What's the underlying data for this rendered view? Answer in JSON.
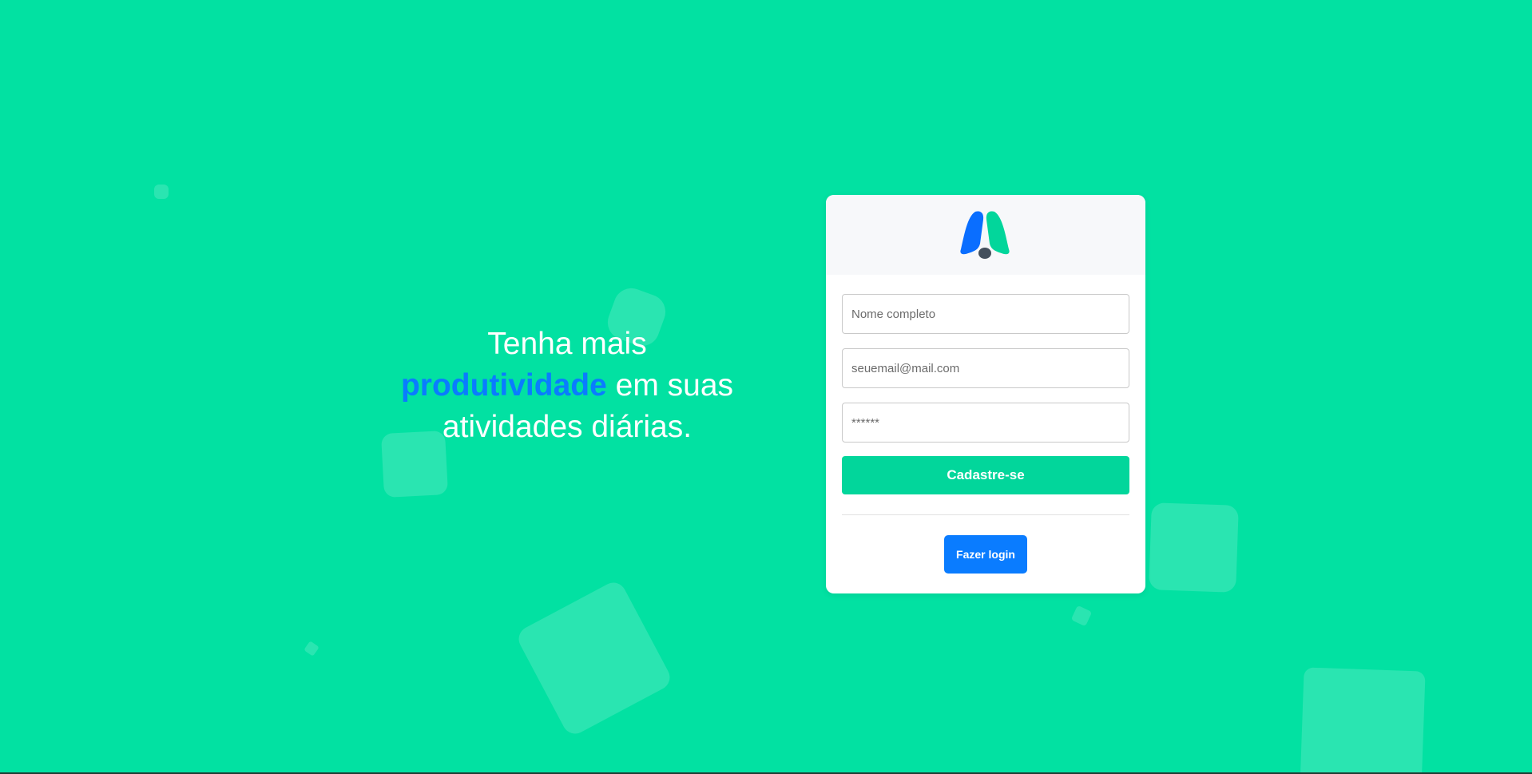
{
  "hero": {
    "line1": "Tenha mais",
    "accent": "produtividade",
    "line2_rest": " em suas",
    "line3": "atividades diárias."
  },
  "form": {
    "name_placeholder": "Nome completo",
    "email_placeholder": "seuemail@mail.com",
    "password_placeholder": "******",
    "signup_label": "Cadastre-se",
    "login_label": "Fazer login"
  },
  "colors": {
    "background": "#02e1a2",
    "accent_blue": "#0a7cff",
    "signup_green": "#02d69b"
  },
  "icons": {
    "logo": "app-logo-icon"
  }
}
